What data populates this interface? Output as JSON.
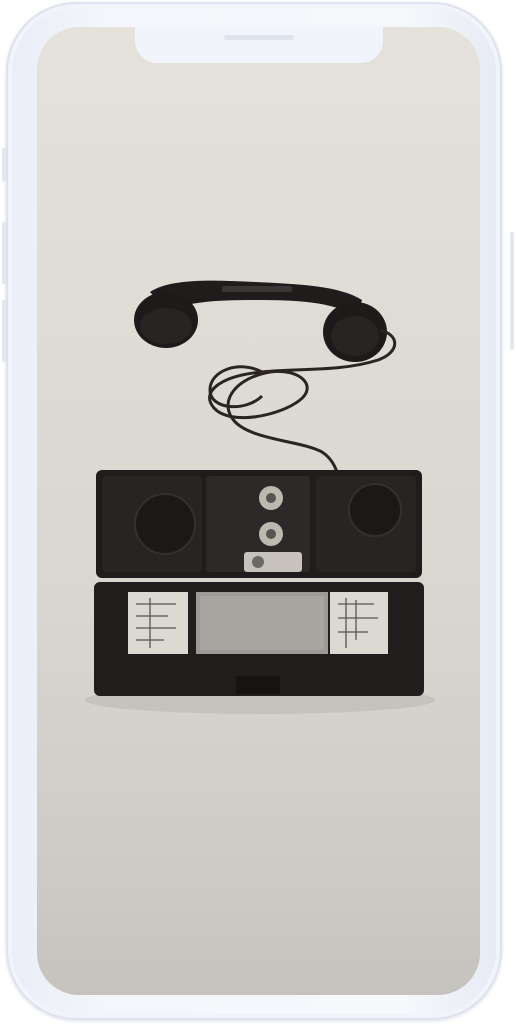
{
  "device": {
    "type": "smartphone-mockup",
    "frame_color": "#eef1f8"
  },
  "screen": {
    "content": "photo",
    "background_color": "#dedad4"
  }
}
